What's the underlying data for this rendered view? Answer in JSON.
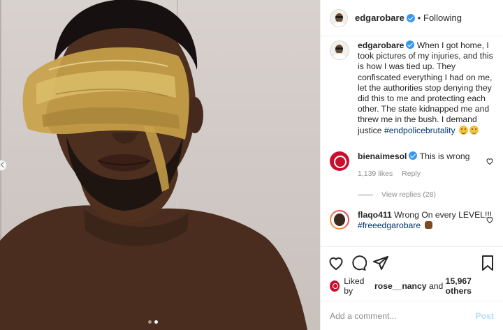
{
  "post": {
    "author": {
      "username": "edgarobare",
      "verified": true,
      "follow_state": "Following",
      "separator": "•"
    },
    "caption": {
      "username": "edgarobare",
      "text": "When I got home, I took pictures of my injuries, and this is how I was tied up. They confiscated everything I had on me, let the authorities stop denying they did this to me and protecting each other. The state kidnapped me and threw me in the bush. I demand justice",
      "hashtag": "#endpolicebrutality"
    },
    "comments": [
      {
        "username": "bienaimesol",
        "verified": true,
        "text": "This is wrong",
        "likes": "1,139 likes",
        "reply_label": "Reply",
        "view_replies": "View replies (28)"
      },
      {
        "username": "flaqo411",
        "verified": false,
        "text": "Wrong On every LEVEL!!!",
        "hashtag": "#freeedgarobare"
      }
    ],
    "likes": {
      "prefix": "Liked by",
      "user": "rose__nancy",
      "conjunction": "and",
      "others": "15,967 others"
    },
    "add_comment": {
      "placeholder": "Add a comment...",
      "post_label": "Post"
    },
    "carousel": {
      "count": 2,
      "active": 2
    },
    "icons": [
      "heart-icon",
      "comment-icon",
      "share-icon",
      "bookmark-icon",
      "verified-icon",
      "small-heart-icon"
    ],
    "colors": {
      "link": "#00376b",
      "verified": "#3897f0",
      "muted": "#8e8e8e",
      "post_disabled": "#b2dffc"
    }
  }
}
